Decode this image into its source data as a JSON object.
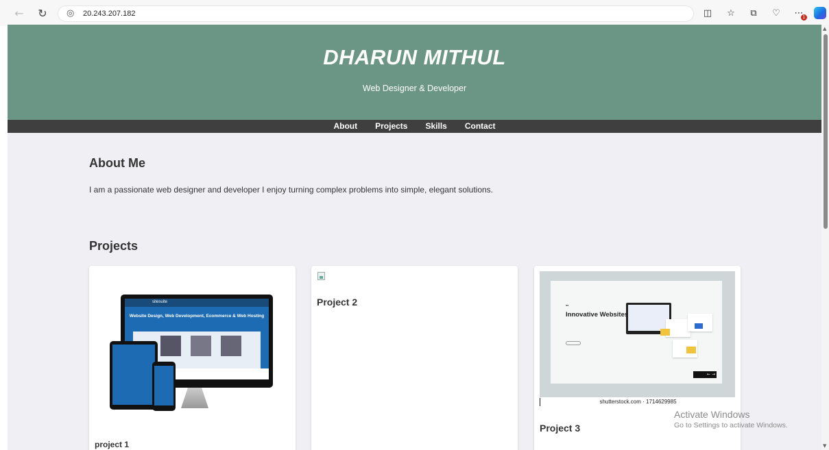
{
  "browser": {
    "url": "20.243.207.182",
    "notification_count": "1"
  },
  "site": {
    "title": "DHARUN MITHUL",
    "subtitle": "Web Designer & Developer",
    "nav": [
      "About",
      "Projects",
      "Skills",
      "Contact"
    ]
  },
  "about": {
    "heading": "About Me",
    "text": "I am a passionate web designer and developer I enjoy turning complex problems into simple, elegant solutions."
  },
  "projects": {
    "heading": "Projects",
    "items": [
      {
        "title": "project 1",
        "image": {
          "brand": "sitesuite",
          "headline": "Website Design, Web Development, Ecommerce & Web Hosting"
        }
      },
      {
        "title": "Project 2"
      },
      {
        "title": "Project 3",
        "image": {
          "heading": "Innovative Websites",
          "watermark": "shutterstock.com · 1714629985"
        }
      }
    ]
  },
  "os_overlay": {
    "title": "Activate Windows",
    "subtitle": "Go to Settings to activate Windows."
  },
  "colors": {
    "header_bg": "#6b9685",
    "nav_bg": "#3f3f3f",
    "page_bg": "#f0f0f4"
  }
}
